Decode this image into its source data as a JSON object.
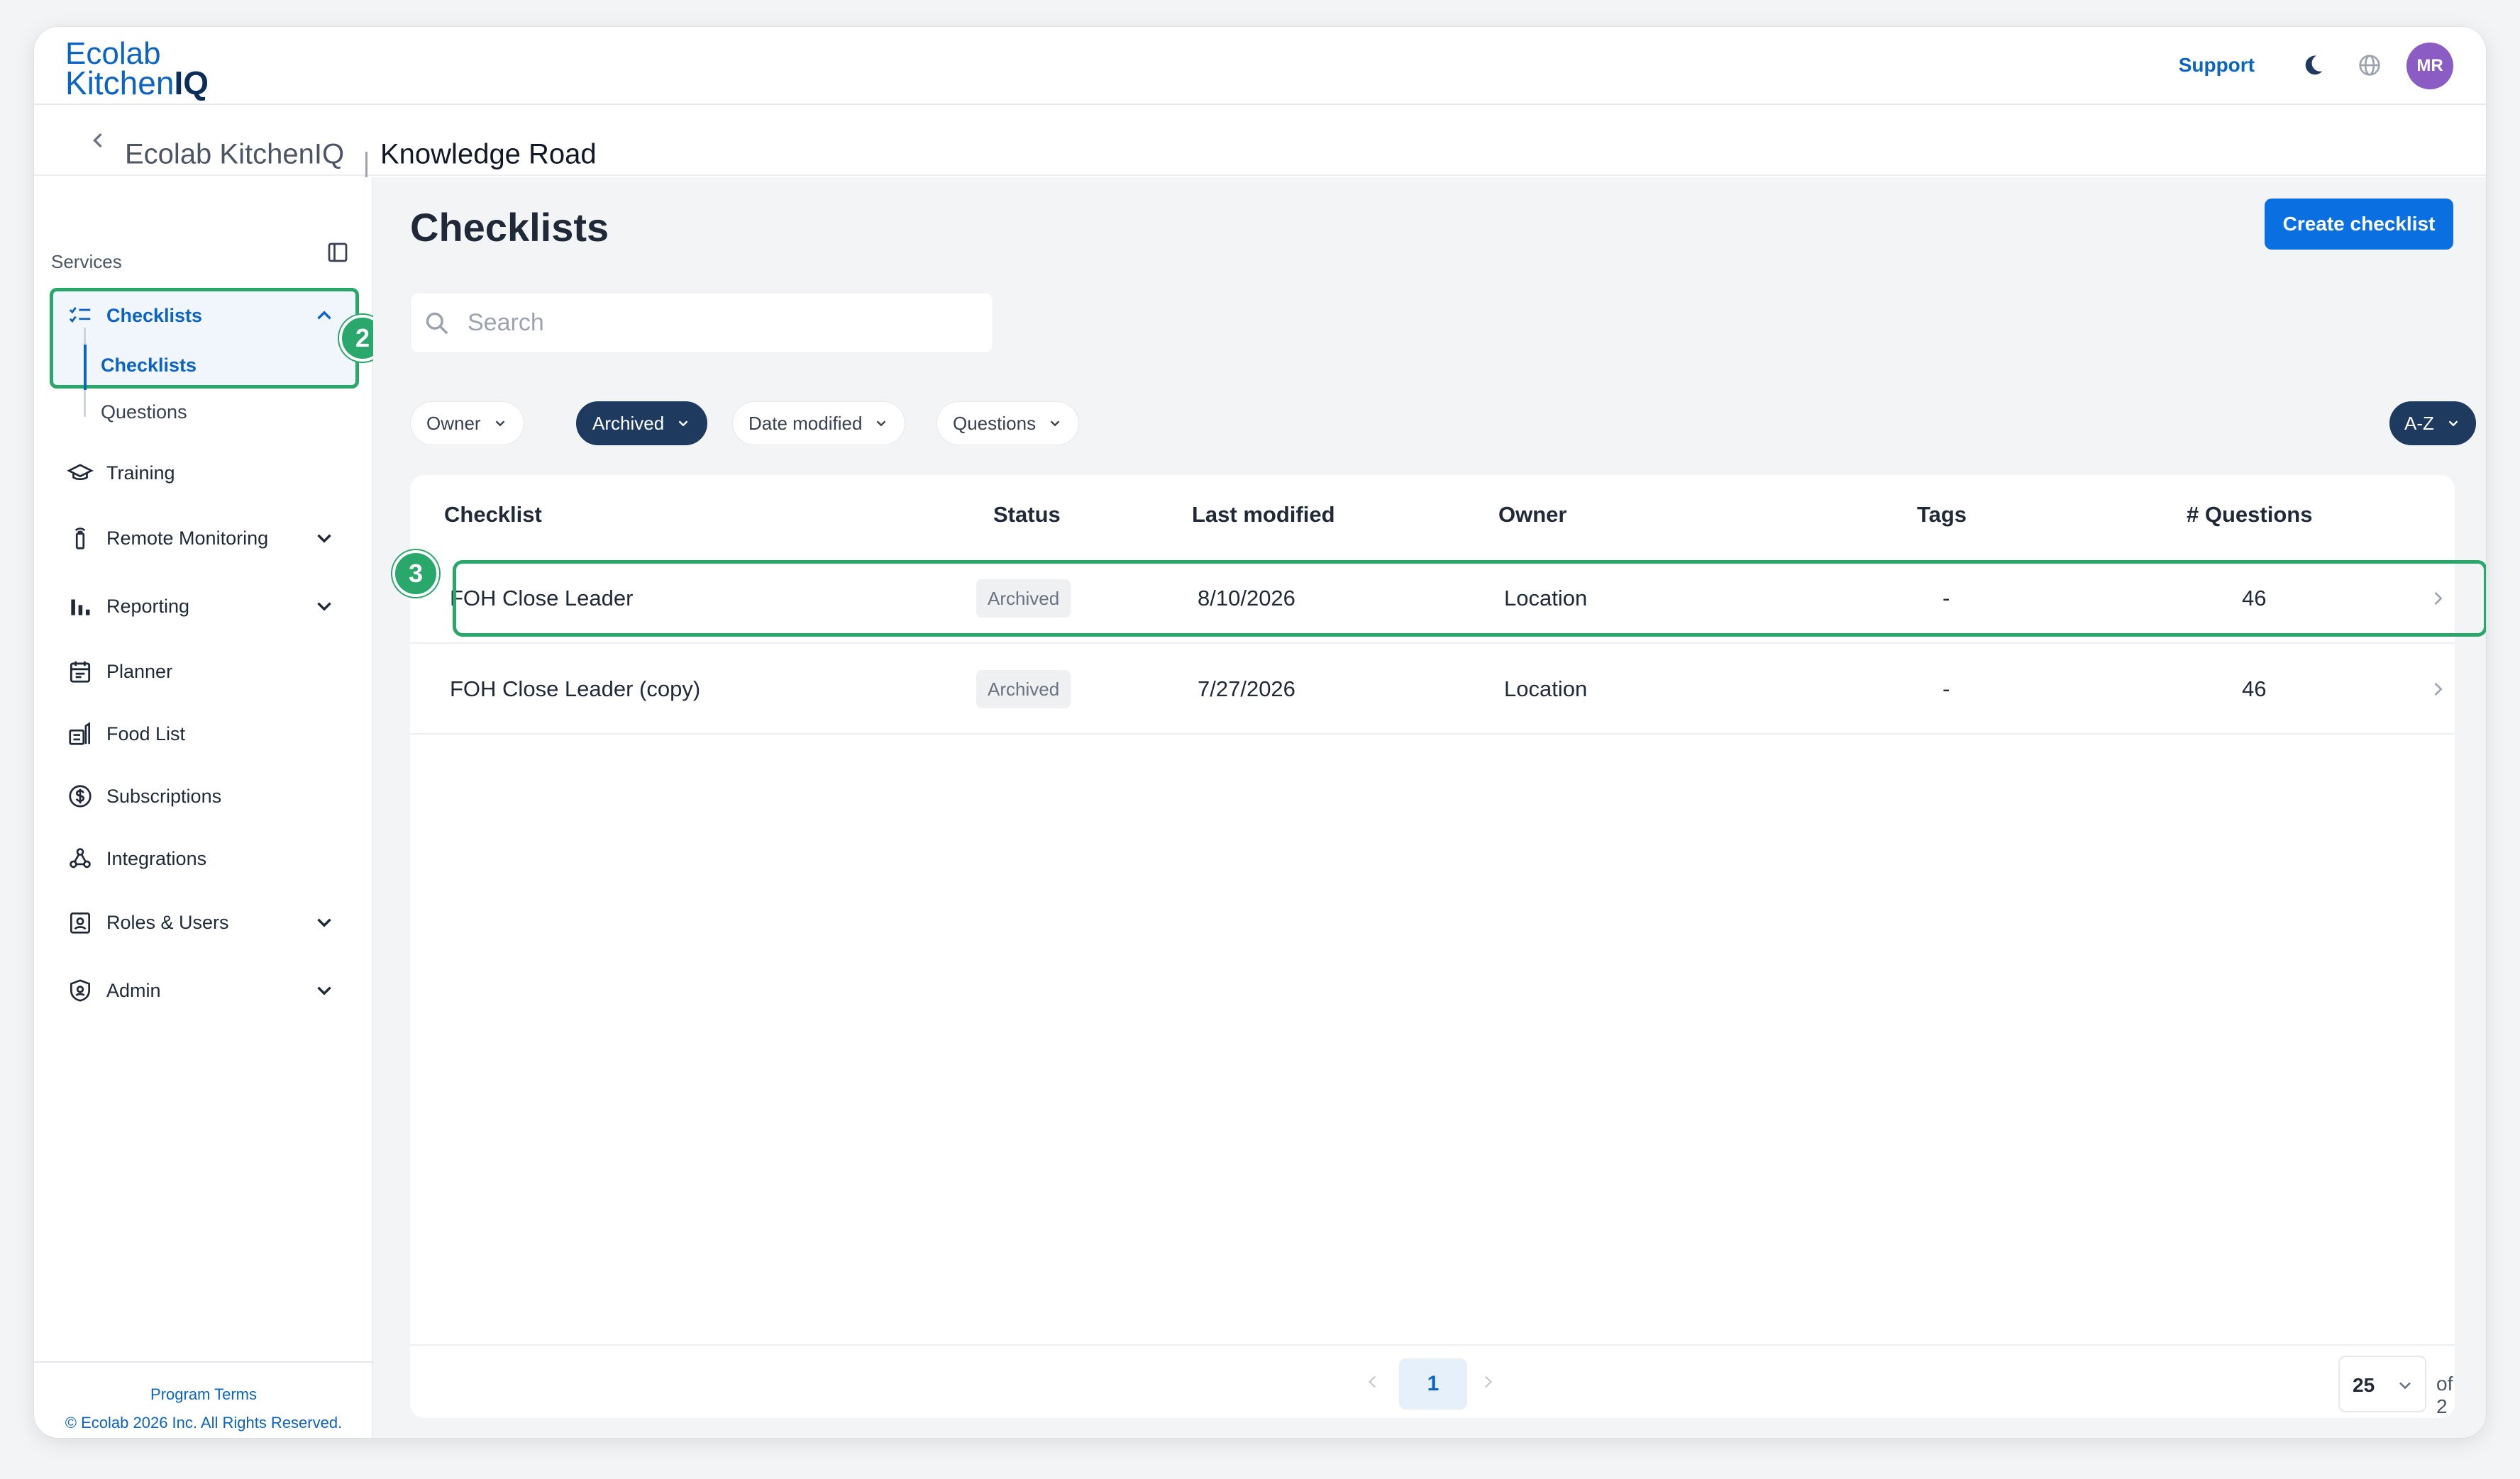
{
  "app": {
    "logo_line1": "Ecolab",
    "logo_line2_regular": "Kitchen",
    "logo_line2_bold": "IQ",
    "support_label": "Support",
    "avatar_initials": "MR",
    "breadcrumb": [
      "Ecolab KitchenIQ",
      "Knowledge Road"
    ]
  },
  "sidebar": {
    "section_label": "Services",
    "items": [
      {
        "label": "Checklists",
        "icon": "checklist-icon",
        "expanded": true
      },
      {
        "label": "Training",
        "icon": "graduation-cap-icon"
      },
      {
        "label": "Remote Monitoring",
        "icon": "sensor-icon",
        "expandable": true
      },
      {
        "label": "Reporting",
        "icon": "bar-chart-icon",
        "expandable": true
      },
      {
        "label": "Planner",
        "icon": "calendar-icon"
      },
      {
        "label": "Food List",
        "icon": "food-list-icon"
      },
      {
        "label": "Subscriptions",
        "icon": "dollar-circle-icon"
      },
      {
        "label": "Integrations",
        "icon": "webhook-icon"
      },
      {
        "label": "Roles & Users",
        "icon": "id-badge-icon",
        "expandable": true
      },
      {
        "label": "Admin",
        "icon": "shield-icon",
        "expandable": true
      }
    ],
    "checklists_sub": [
      "Checklists",
      "Questions"
    ],
    "footer_terms": "Program Terms",
    "footer_copyright": "© Ecolab 2026 Inc. All Rights Reserved."
  },
  "annotations": {
    "step_sidebar": "2",
    "step_row": "3"
  },
  "main": {
    "title": "Checklists",
    "create_button": "Create checklist",
    "search_placeholder": "Search",
    "filters": [
      {
        "label": "Owner",
        "active": false
      },
      {
        "label": "Archived",
        "active": true
      },
      {
        "label": "Date modified",
        "active": false
      },
      {
        "label": "Questions",
        "active": false
      }
    ],
    "sort_label": "A-Z",
    "table": {
      "columns": [
        "Checklist",
        "Status",
        "Last modified",
        "Owner",
        "Tags",
        "# Questions"
      ],
      "rows": [
        {
          "name": "FOH Close Leader",
          "status": "Archived",
          "last_modified": "8/10/2026",
          "owner": "Location",
          "tags": "-",
          "questions": "46"
        },
        {
          "name": "FOH Close Leader (copy)",
          "status": "Archived",
          "last_modified": "7/27/2026",
          "owner": "Location",
          "tags": "-",
          "questions": "46"
        }
      ]
    },
    "pagination": {
      "current_page": "1",
      "per_page": "25",
      "of_pages": "of 2"
    }
  },
  "colors": {
    "accent": "#0a6fe0",
    "highlight": "#2aa76a",
    "active_filter": "#1e3a5f",
    "avatar": "#8b5cc4"
  }
}
